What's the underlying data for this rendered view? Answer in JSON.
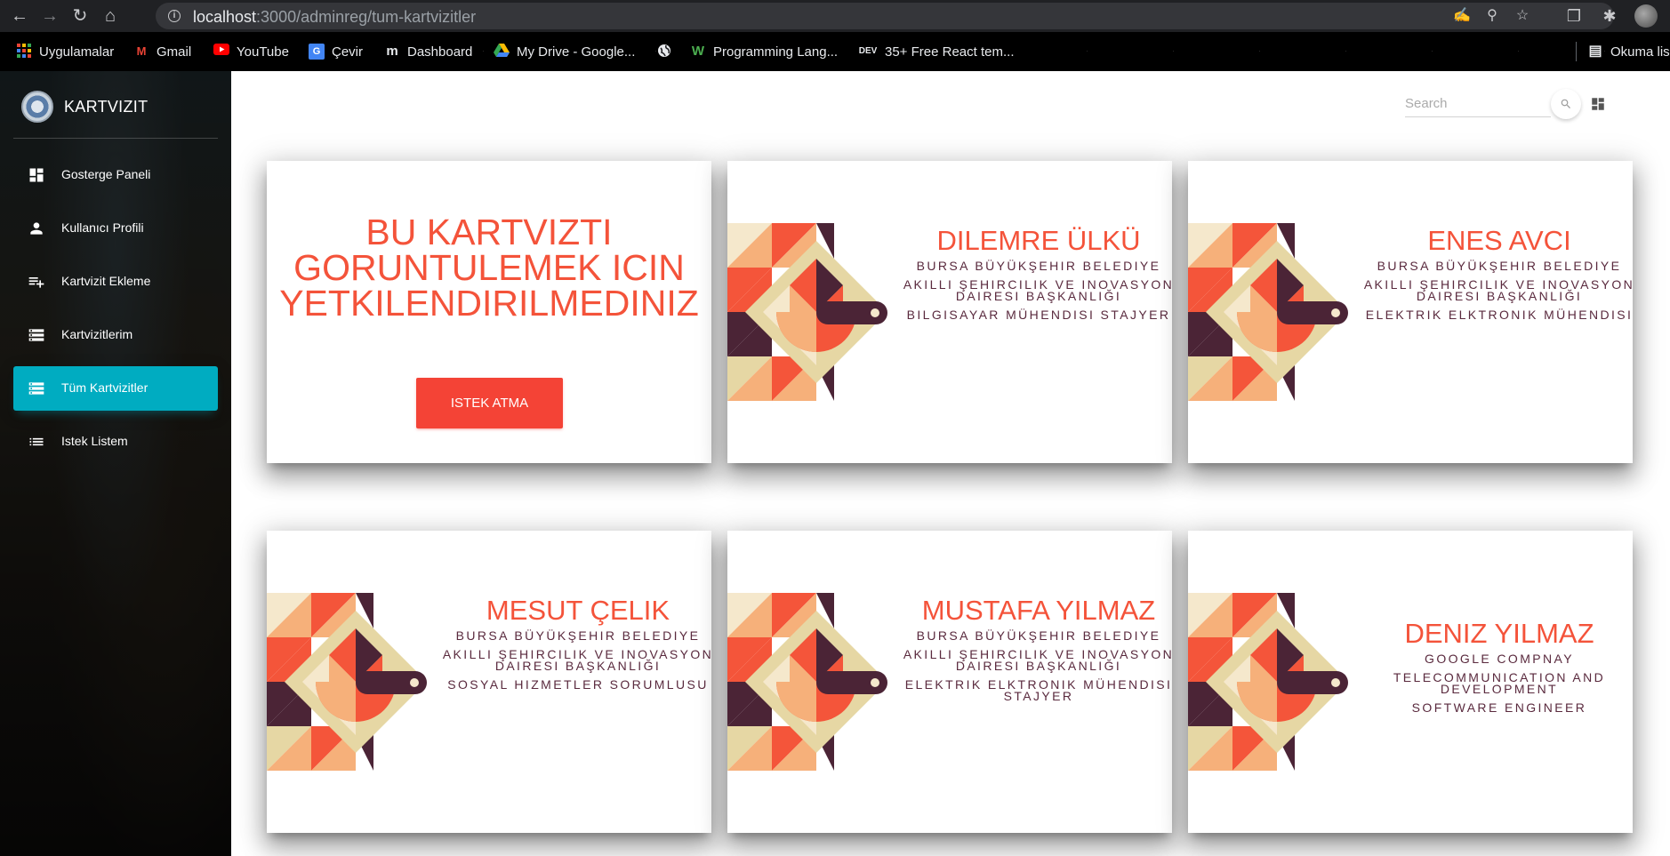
{
  "browser": {
    "url_host": "localhost",
    "url_path": ":3000/adminreg/tum-kartvizitler",
    "bookmarks": [
      {
        "label": "Uygulamalar",
        "icon": "apps-grid-icon"
      },
      {
        "label": "Gmail",
        "icon": "gmail-icon"
      },
      {
        "label": "YouTube",
        "icon": "youtube-icon"
      },
      {
        "label": "Çevir",
        "icon": "translate-icon"
      },
      {
        "label": "Dashboard",
        "icon": "dashboard-logo-icon"
      },
      {
        "label": "My Drive - Google...",
        "icon": "google-drive-icon"
      },
      {
        "label": "",
        "icon": "globe-icon"
      },
      {
        "label": "Programming Lang...",
        "icon": "w-logo-icon"
      },
      {
        "label": "35+ Free React tem...",
        "icon": "dev-logo-icon"
      },
      {
        "label": "Okuma lis",
        "icon": "reading-list-icon"
      }
    ]
  },
  "sidebar": {
    "brand": "KARTVIZIT",
    "items": [
      {
        "label": "Gosterge Paneli",
        "icon": "dashboard-icon",
        "active": false
      },
      {
        "label": "Kullanıcı Profili",
        "icon": "person-icon",
        "active": false
      },
      {
        "label": "Kartvizit Ekleme",
        "icon": "playlist-add-icon",
        "active": false
      },
      {
        "label": "Kartvizitlerim",
        "icon": "storage-icon",
        "active": false
      },
      {
        "label": "Tüm Kartvizitler",
        "icon": "storage-icon",
        "active": true
      },
      {
        "label": "Istek Listem",
        "icon": "list-icon",
        "active": false
      }
    ]
  },
  "header": {
    "search_placeholder": "Search"
  },
  "locked_card": {
    "message_line1": "BU KARTVIZTI",
    "message_line2": "GORUNTULEMEK ICIN",
    "message_line3": "YETKILENDIRILMEDINIZ",
    "button_label": "ISTEK ATMA"
  },
  "cards": [
    {
      "name": "DILEMRE ÜLKÜ",
      "org": "BURSA BÜYÜKŞEHIR BELEDIYE",
      "dept": "AKILLI ŞEHIRCILIK VE INOVASYON DAIRESI BAŞKANLIĞI",
      "title": "BILGISAYAR MÜHENDISI STAJYER"
    },
    {
      "name": "ENES AVCI",
      "org": "BURSA BÜYÜKŞEHIR BELEDIYE",
      "dept": "AKILLI ŞEHIRCILIK VE INOVASYON DAIRESI BAŞKANLIĞI",
      "title": "ELEKTRIK ELKTRONIK MÜHENDISI"
    },
    {
      "name": "MESUT ÇELIK",
      "org": "BURSA BÜYÜKŞEHIR BELEDIYE",
      "dept": "AKILLI ŞEHIRCILIK VE INOVASYON DAIRESI BAŞKANLIĞI",
      "title": "SOSYAL HIZMETLER SORUMLUSU"
    },
    {
      "name": "MUSTAFA YILMAZ",
      "org": "BURSA BÜYÜKŞEHIR BELEDIYE",
      "dept": "AKILLI ŞEHIRCILIK VE INOVASYON DAIRESI BAŞKANLIĞI",
      "title": "ELEKTRIK ELKTRONIK MÜHENDISI STAJYER"
    },
    {
      "name": "DENIZ YILMAZ",
      "org": "GOOGLE COMPNAY",
      "dept": "TELECOMMUNICATION AND DEVELOPMENT",
      "title": "SOFTWARE ENGINEER"
    }
  ],
  "colors": {
    "accent_cyan": "#00acc1",
    "accent_red": "#f44336",
    "card_name": "#f4533a",
    "card_text": "#5a2a3e"
  }
}
